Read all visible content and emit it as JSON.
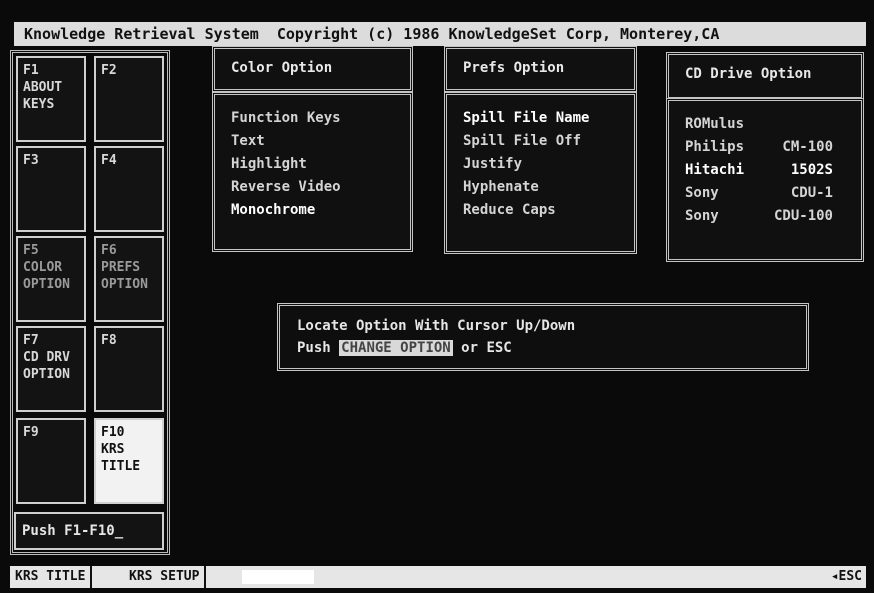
{
  "title": "Knowledge Retrieval System  Copyright (c) 1986 KnowledgeSet Corp, Monterey,CA",
  "fkeys": [
    {
      "label": "F1\nABOUT\nKEYS"
    },
    {
      "label": "F2"
    },
    {
      "label": "F3"
    },
    {
      "label": "F4"
    },
    {
      "label": "F5\nCOLOR\nOPTION"
    },
    {
      "label": "F6\nPREFS\nOPTION"
    },
    {
      "label": "F7\nCD DRV\nOPTION"
    },
    {
      "label": "F8"
    },
    {
      "label": "F9"
    },
    {
      "label": "F10\nKRS\nTITLE",
      "active": true
    }
  ],
  "prompt": "Push F1-F10_",
  "color_option": {
    "title": "Color Option",
    "items": [
      "Function Keys",
      "Text",
      "Highlight",
      "Reverse Video",
      "Monochrome"
    ],
    "selected": "Monochrome"
  },
  "prefs_option": {
    "title": "Prefs Option",
    "items": [
      "Spill File Name",
      "Spill File Off",
      "Justify",
      "Hyphenate",
      "Reduce Caps"
    ],
    "selected": "Spill File Name"
  },
  "cd_option": {
    "title": "CD Drive Option",
    "items": [
      {
        "brand": "ROMulus",
        "model": ""
      },
      {
        "brand": "Philips",
        "model": "CM-100"
      },
      {
        "brand": "Hitachi",
        "model": "1502S"
      },
      {
        "brand": "Sony",
        "model": "CDU-1"
      },
      {
        "brand": "Sony",
        "model": "CDU-100"
      }
    ],
    "selected": 2
  },
  "message": {
    "line1": "Locate Option With Cursor Up/Down",
    "line2_prefix": "Push ",
    "highlight": "CHANGE OPTION",
    "line2_suffix": " or ESC"
  },
  "status_bar": {
    "tabs": [
      "KRS TITLE",
      "KRS SETUP"
    ],
    "esc_label": "◂ESC"
  }
}
